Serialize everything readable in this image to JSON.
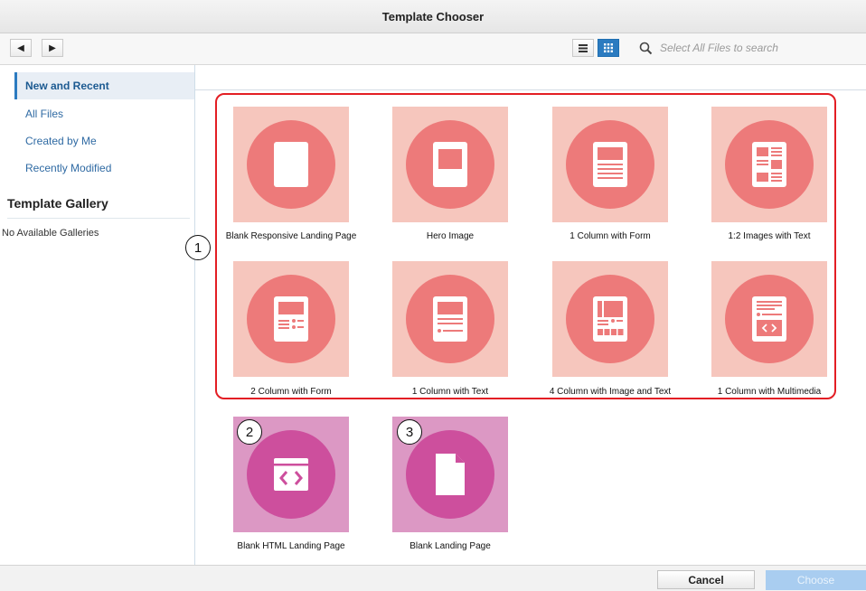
{
  "window": {
    "title": "Template Chooser"
  },
  "toolbar": {
    "back_icon": "◀",
    "forward_icon": "▶",
    "list_view_icon": "≡",
    "grid_view_icon": "▦",
    "search_placeholder": "Select All Files to search"
  },
  "sidebar": {
    "items": [
      {
        "label": "New and Recent",
        "active": true
      },
      {
        "label": "All Files"
      },
      {
        "label": "Created by Me"
      },
      {
        "label": "Recently Modified"
      }
    ],
    "gallery_title": "Template Gallery",
    "gallery_empty": "No Available Galleries"
  },
  "markers": [
    "1",
    "2",
    "3"
  ],
  "templates": [
    {
      "label": "Blank Responsive Landing Page",
      "icon": "blank-page-icon"
    },
    {
      "label": "Hero Image",
      "icon": "hero-image-icon"
    },
    {
      "label": "1 Column with Form",
      "icon": "one-column-form-icon"
    },
    {
      "label": "1:2 Images with Text",
      "icon": "images-with-text-icon"
    },
    {
      "label": "2 Column with Form",
      "icon": "two-column-form-icon"
    },
    {
      "label": "1 Column with Text",
      "icon": "one-column-text-icon"
    },
    {
      "label": "4 Column with Image and Text",
      "icon": "four-column-icon"
    },
    {
      "label": "1 Column with Multimedia",
      "icon": "multimedia-icon"
    },
    {
      "label": "Blank HTML Landing Page",
      "icon": "html-code-icon"
    },
    {
      "label": "Blank Landing Page",
      "icon": "document-icon"
    }
  ],
  "colors": {
    "accent": "#2b7bc0",
    "tile_salmon": "#f6c6bd",
    "disc_salmon": "#ed7a7a",
    "tile_pink": "#dc98c4",
    "disc_pink": "#cd4f9d",
    "highlight_border": "#e31e24"
  },
  "footer": {
    "cancel_label": "Cancel",
    "choose_label": "Choose"
  }
}
